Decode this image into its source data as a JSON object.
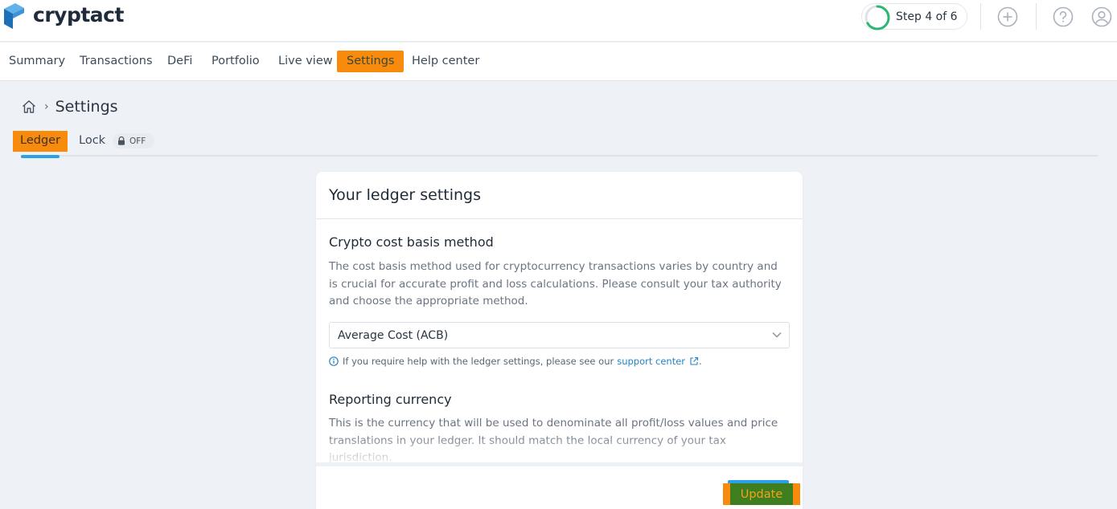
{
  "header": {
    "logo_text": "cryptact",
    "step_label": "Step 4 of 6",
    "step_progress": 0.667,
    "icons": [
      "plus-circle-icon",
      "question-circle-icon",
      "user-circle-icon"
    ]
  },
  "nav": {
    "items": [
      {
        "label": "Summary"
      },
      {
        "label": "Transactions"
      },
      {
        "label": "DeFi"
      },
      {
        "label": "Portfolio"
      },
      {
        "label": "Live view"
      },
      {
        "label": "Settings",
        "active": true
      },
      {
        "label": "Help center"
      }
    ]
  },
  "breadcrumb": {
    "home_icon": "home-icon",
    "title": "Settings"
  },
  "tabs": {
    "ledger": "Ledger",
    "lock": "Lock",
    "lock_status": "OFF"
  },
  "card": {
    "title": "Your ledger settings",
    "cost_basis": {
      "title": "Crypto cost basis method",
      "description": "The cost basis method used for cryptocurrency transactions varies by country and is crucial for accurate profit and loss calculations. Please consult your tax authority and choose the appropriate method.",
      "selected": "Average Cost (ACB)",
      "help_text": "If you require help with the ledger settings, please see our",
      "help_link": "support center",
      "help_end": "."
    },
    "reporting_currency": {
      "title": "Reporting currency",
      "description": "This is the currency that will be used to denominate all profit/loss values and price translations in your ledger. It should match the local currency of your tax jurisdiction."
    },
    "update_label": "Update"
  },
  "colors": {
    "highlight_orange": "#f88a0c",
    "accent_blue": "#2aa0e6",
    "step_green": "#2bb673",
    "update_green": "#3f7e1f",
    "link_blue": "#2683c6"
  }
}
